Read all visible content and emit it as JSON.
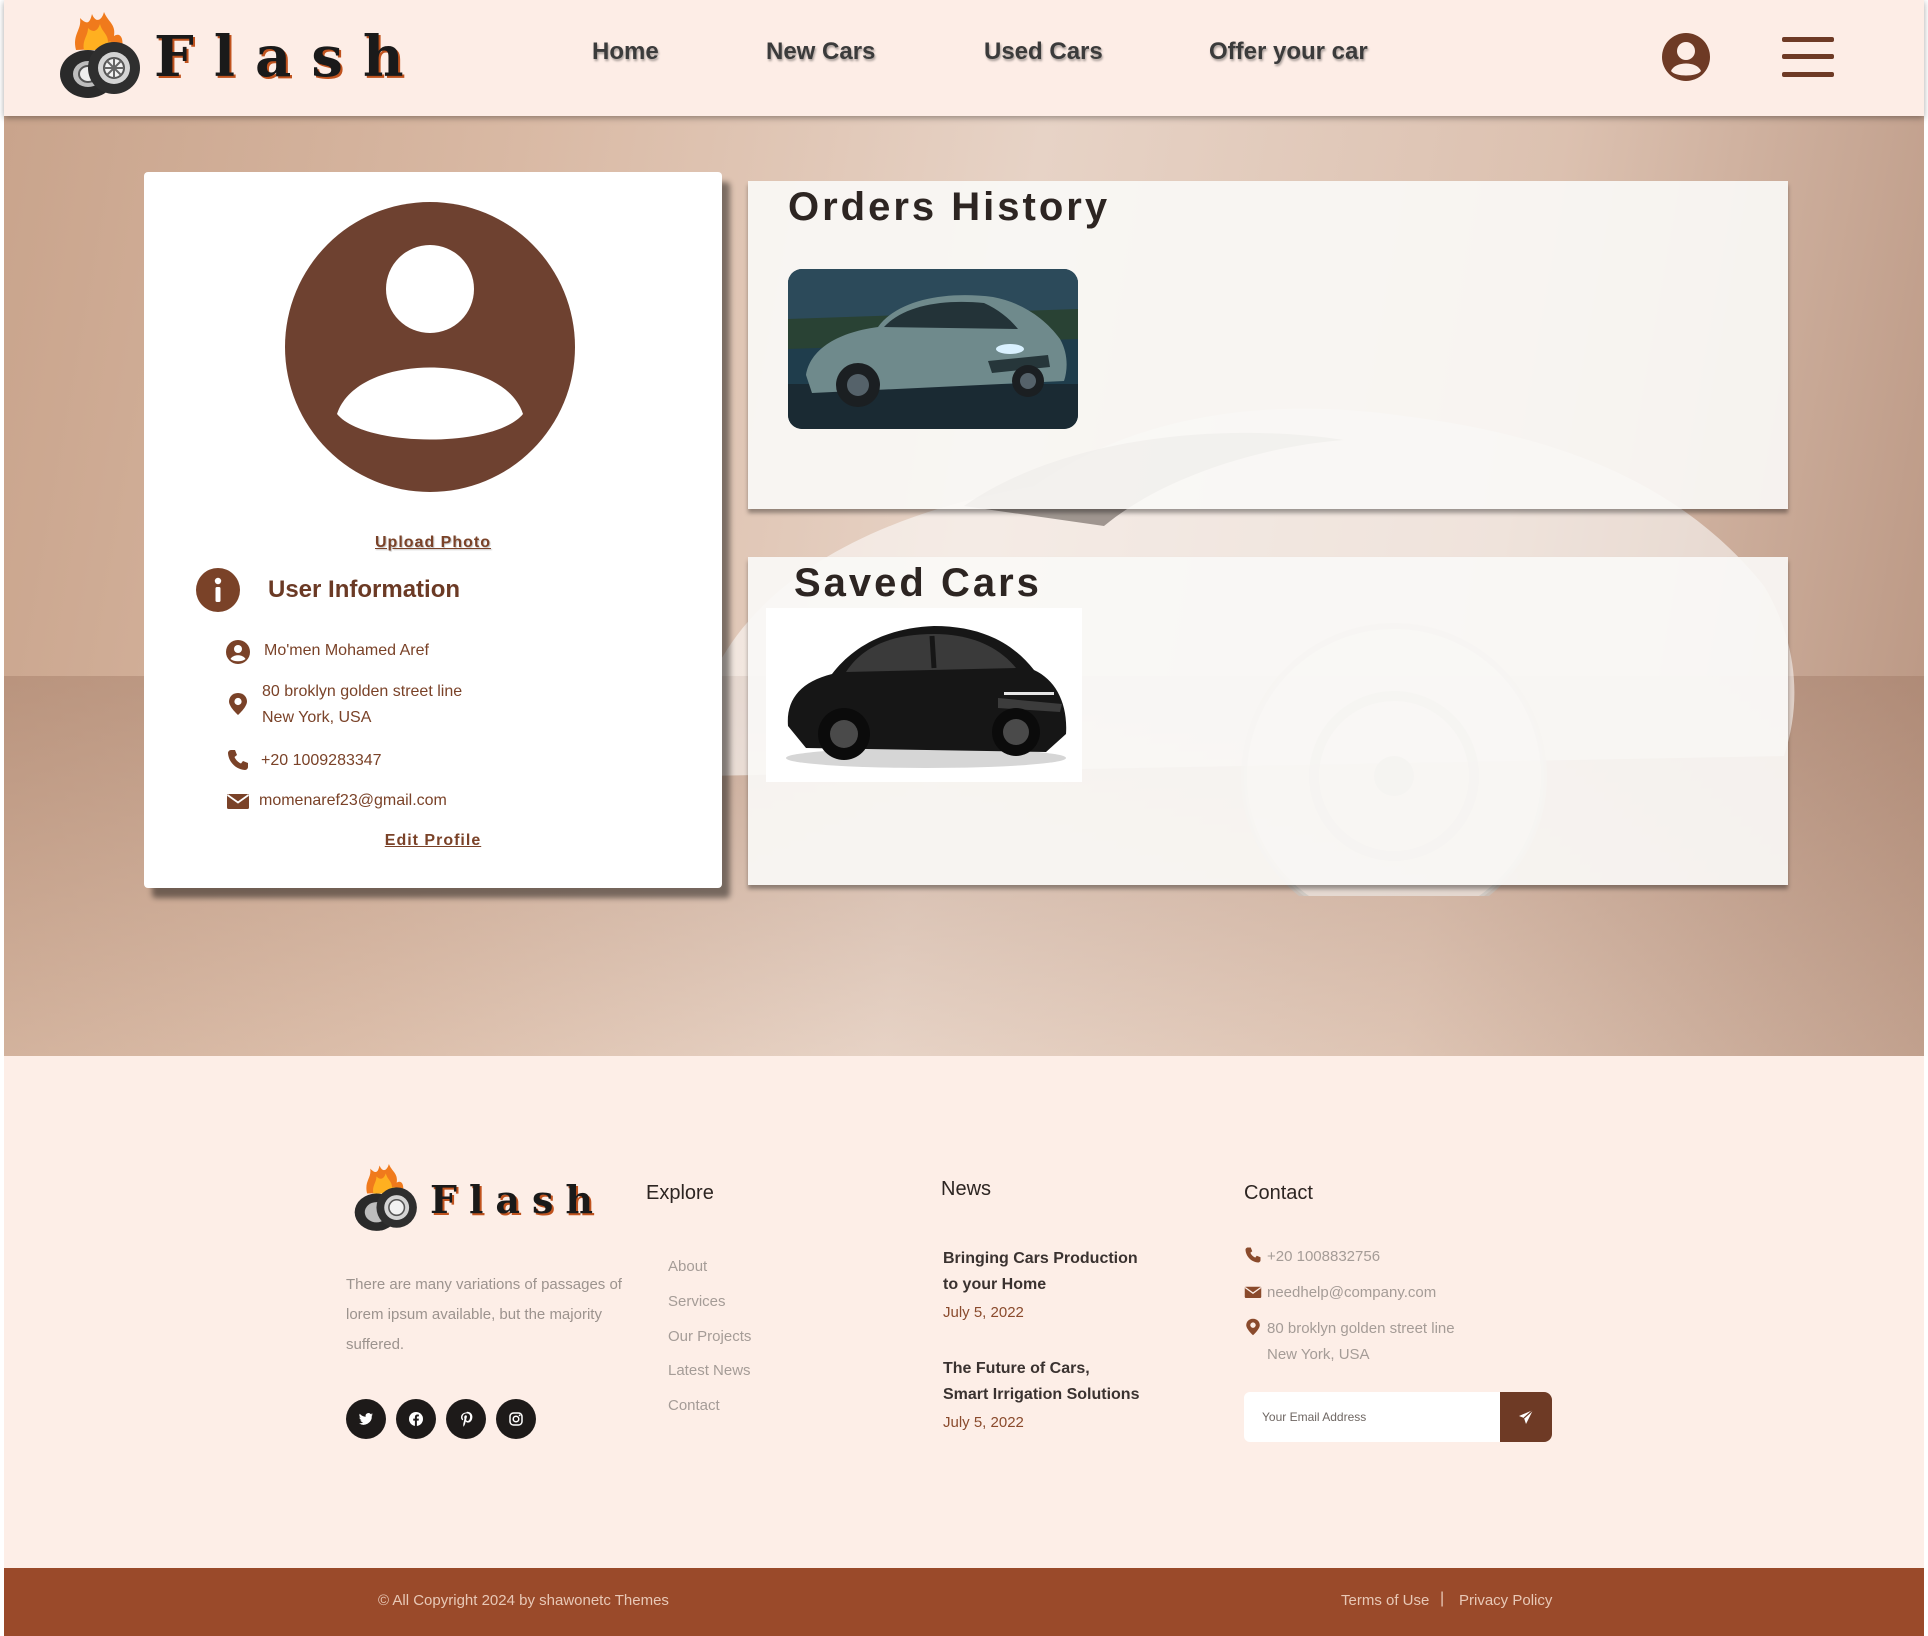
{
  "header": {
    "brand": "Flash",
    "nav": [
      "Home",
      "New Cars",
      "Used Cars",
      "Offer your car"
    ],
    "user_icon": "user-circle-icon",
    "menu_icon": "hamburger-menu-icon"
  },
  "profile": {
    "upload_label": "Upload Photo",
    "section_title": "User Information",
    "name": "Mo'men Mohamed Aref",
    "address_line1": "80 broklyn golden street line",
    "address_line2": "New York, USA",
    "phone": "+20 1009283347",
    "email": "momenaref23@gmail.com",
    "edit_label": "Edit Profile"
  },
  "orders": {
    "title": "Orders History",
    "items": [
      {
        "image": "grey-sports-coupe"
      }
    ]
  },
  "saved": {
    "title": "Saved Cars",
    "items": [
      {
        "image": "black-suv"
      }
    ]
  },
  "footer": {
    "brand": "Flash",
    "description": "There are many variations of passages of lorem ipsum available, but the majority suffered.",
    "social": [
      "twitter-icon",
      "facebook-icon",
      "pinterest-icon",
      "instagram-icon"
    ],
    "explore": {
      "heading": "Explore",
      "links": [
        "About",
        "Services",
        "Our Projects",
        "Latest News",
        "Contact"
      ]
    },
    "news": {
      "heading": "News",
      "items": [
        {
          "line1": "Bringing Cars Production",
          "line2": "to your Home",
          "date": "July 5, 2022"
        },
        {
          "line1": "The Future of Cars,",
          "line2": "Smart Irrigation Solutions",
          "date": "July 5, 2022"
        }
      ]
    },
    "contact": {
      "heading": "Contact",
      "phone": "+20 1008832756",
      "email": "needhelp@company.com",
      "address_line1": "80 broklyn golden street line",
      "address_line2": "New York, USA",
      "newsletter_placeholder": "Your Email Address"
    }
  },
  "bottom": {
    "copyright": "© All Copyright 2024 by shawonetc Themes",
    "terms": "Terms of Use",
    "separator": "|",
    "privacy": "Privacy Policy"
  },
  "colors": {
    "accent": "#6e3a25",
    "header_bg": "#fdede6",
    "footer_bar": "#9a4a2a"
  }
}
